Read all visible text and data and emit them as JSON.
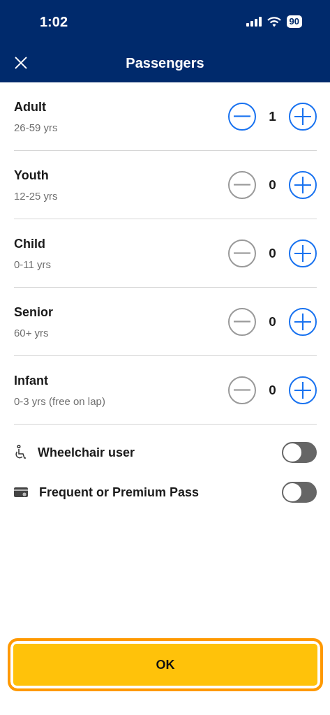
{
  "status_bar": {
    "time": "1:02",
    "battery": "90"
  },
  "header": {
    "title": "Passengers"
  },
  "passengers": [
    {
      "label": "Adult",
      "age": "26-59 yrs",
      "count": "1",
      "minus_disabled": false
    },
    {
      "label": "Youth",
      "age": "12-25 yrs",
      "count": "0",
      "minus_disabled": true
    },
    {
      "label": "Child",
      "age": "0-11 yrs",
      "count": "0",
      "minus_disabled": true
    },
    {
      "label": "Senior",
      "age": "60+ yrs",
      "count": "0",
      "minus_disabled": true
    },
    {
      "label": "Infant",
      "age": "0-3 yrs (free on lap)",
      "count": "0",
      "minus_disabled": true
    }
  ],
  "options": [
    {
      "kind": "wheelchair",
      "label": "Wheelchair user",
      "on": false
    },
    {
      "kind": "pass",
      "label": "Frequent or Premium Pass",
      "on": false
    }
  ],
  "ok_button": {
    "label": "OK",
    "focused": true
  }
}
